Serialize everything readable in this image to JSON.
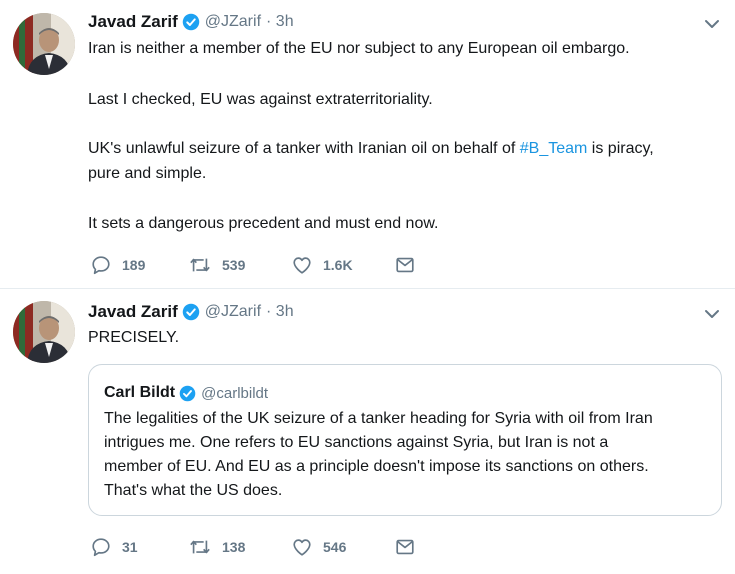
{
  "tweets": [
    {
      "author": {
        "name": "Javad Zarif",
        "handle": "@JZarif",
        "time": "· 3h",
        "verified": true
      },
      "paragraphs": [
        "Iran is neither a member of the EU nor subject to any European oil embargo.",
        "Last I checked, EU was against extraterritoriality.",
        "UK's unlawful seizure of a tanker with Iranian oil on behalf of",
        "#B_Team",
        "is piracy,",
        "pure and simple.",
        "It sets a dangerous precedent and must end now."
      ],
      "actions": {
        "replies": "189",
        "retweets": "539",
        "likes": "1.6K"
      }
    },
    {
      "author": {
        "name": "Javad Zarif",
        "handle": "@JZarif",
        "time": "· 3h",
        "verified": true
      },
      "text": "PRECISELY.",
      "quoted": {
        "author": {
          "name": "Carl Bildt",
          "handle": "@carlbildt",
          "verified": true
        },
        "lines": [
          "The legalities of the UK seizure of a tanker heading for Syria with oil from Iran",
          "intrigues me. One refers to EU sanctions against Syria, but Iran is not a",
          "member of EU. And EU as a principle doesn't impose its sanctions on others.",
          "That's what the US does."
        ]
      },
      "actions": {
        "replies": "31",
        "retweets": "138",
        "likes": "546"
      }
    }
  ],
  "icons": {
    "reply": "reply-icon",
    "retweet": "retweet-icon",
    "like": "heart-icon",
    "dm": "envelope-icon",
    "verified": "verified-badge-icon",
    "more": "chevron-down-icon"
  },
  "colors": {
    "link": "#1b95e0",
    "secondary": "#657786",
    "verified": "#1da1f2",
    "icon": "#657786"
  }
}
